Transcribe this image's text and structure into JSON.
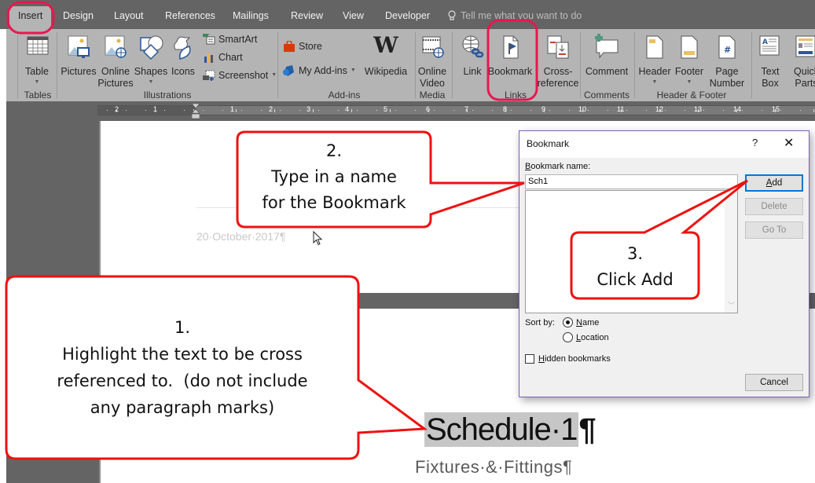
{
  "tabs": [
    {
      "label": "Insert",
      "active": true
    },
    {
      "label": "Design"
    },
    {
      "label": "Layout"
    },
    {
      "label": "References"
    },
    {
      "label": "Mailings"
    },
    {
      "label": "Review"
    },
    {
      "label": "View"
    },
    {
      "label": "Developer"
    }
  ],
  "tell_me": {
    "placeholder": "Tell me what you want to do",
    "icon": "lightbulb-icon"
  },
  "ribbon": {
    "groups": {
      "tables": "Tables",
      "illustrations": "Illustrations",
      "addins": "Add-ins",
      "media": "Media",
      "links": "Links",
      "comments": "Comments",
      "header_footer": "Header & Footer"
    },
    "buttons": {
      "table": {
        "label": "Table",
        "icon": "table-icon"
      },
      "pictures": {
        "label": "Pictures",
        "icon": "pictures-icon"
      },
      "online_pictures_1": "Online",
      "online_pictures_2": "Pictures",
      "shapes": {
        "label": "Shapes",
        "icon": "shapes-icon"
      },
      "icons": {
        "label": "Icons",
        "icon": "icons-icon"
      },
      "smartart": {
        "label": "SmartArt",
        "icon": "smartart-icon"
      },
      "chart": {
        "label": "Chart",
        "icon": "chart-icon"
      },
      "screenshot": {
        "label": "Screenshot",
        "icon": "screenshot-icon"
      },
      "store": {
        "label": "Store",
        "icon": "store-icon"
      },
      "my_addins": {
        "label": "My Add-ins",
        "icon": "my-addins-icon"
      },
      "wikipedia": {
        "label": "Wikipedia",
        "icon": "wikipedia-icon"
      },
      "online_video_1": "Online",
      "online_video_2": "Video",
      "link": {
        "label": "Link",
        "icon": "link-icon"
      },
      "bookmark": {
        "label": "Bookmark",
        "icon": "bookmark-icon"
      },
      "cross_ref_1": "Cross-",
      "cross_ref_2": "reference",
      "comment": {
        "label": "Comment",
        "icon": "comment-icon"
      },
      "header": {
        "label": "Header",
        "icon": "header-icon"
      },
      "footer": {
        "label": "Footer",
        "icon": "footer-icon"
      },
      "page_number_1": "Page",
      "page_number_2": "Number",
      "text_box_1": "Text",
      "text_box_2": "Box",
      "quick_parts_1": "Quick",
      "quick_parts_2": "Parts"
    }
  },
  "ruler": {
    "left_labels": [
      "2",
      "1"
    ],
    "right_labels": [
      "1",
      "2",
      "3",
      "4",
      "5",
      "6",
      "7",
      "8",
      "9",
      "10",
      "11",
      "12",
      "13",
      "14",
      "15"
    ]
  },
  "document": {
    "header_date": "20·October·2017¶",
    "schedule_selected": "Schedule·1",
    "schedule_mark": "¶",
    "subtitle": "Fixtures·&·Fittings¶"
  },
  "dialog": {
    "title": "Bookmark",
    "help": "?",
    "close": "✕",
    "name_label_first": "B",
    "name_label_rest": "ookmark name:",
    "name_value": "Sch1",
    "buttons": {
      "add_first": "A",
      "add_rest": "dd",
      "delete": "Delete",
      "goto": "Go To",
      "cancel": "Cancel"
    },
    "sort_by_label": "Sort by:",
    "sort_options": [
      {
        "first": "N",
        "rest": "ame",
        "checked": true
      },
      {
        "first": "L",
        "rest": "ocation",
        "checked": false
      }
    ],
    "hidden_first": "H",
    "hidden_rest": "idden bookmarks",
    "hidden_checked": false
  },
  "callouts": {
    "step1": {
      "number": "1.",
      "lines": [
        "Highlight the text to be cross",
        "referenced to.  (do not include",
        "any paragraph marks)"
      ]
    },
    "step2": {
      "number": "2.",
      "lines": [
        "Type in a name",
        "for the Bookmark"
      ]
    },
    "step3": {
      "number": "3.",
      "lines": [
        "Click Add"
      ]
    }
  },
  "colors": {
    "callout_border": "#ee1111",
    "highlight_ring": "#e8174f",
    "dialog_border": "#7e5fb0",
    "default_button_border": "#0078d7"
  }
}
